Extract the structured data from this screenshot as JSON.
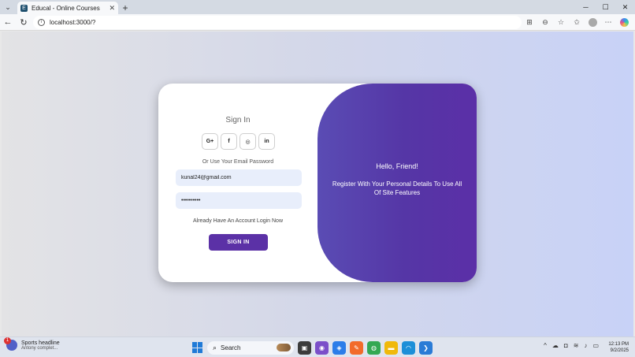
{
  "browser": {
    "tab_title": "Educal - Online Courses",
    "tab_favicon": "E",
    "tab_close": "✕",
    "new_tab": "+",
    "address": "localhost:3000/?",
    "controls": {
      "minimize": "─",
      "maximize": "☐",
      "close": "✕"
    },
    "nav": {
      "back": "←",
      "refresh": "↻"
    }
  },
  "signin": {
    "title": "Sign In",
    "social": [
      {
        "label": "G+",
        "icon": "google-plus-icon"
      },
      {
        "label": "f",
        "icon": "facebook-icon"
      },
      {
        "label": "◎",
        "icon": "github-icon"
      },
      {
        "label": "in",
        "icon": "linkedin-icon"
      }
    ],
    "alt_text": "Or Use Your Email Password",
    "email_value": "kunal24@gmail.com",
    "password_value": "••••••••••",
    "account_text": "Already Have An Account Login Now",
    "button_label": "SIGN IN"
  },
  "panel": {
    "title": "Hello, Friend!",
    "text": "Register With Your Personal Details To Use All Of Site Features"
  },
  "taskbar": {
    "widget_title": "Sports headline",
    "widget_sub": "Antony complet...",
    "widget_badge": "1",
    "search_label": "Search",
    "time": "12:13 PM",
    "date": "9/2/2025"
  },
  "colors": {
    "accent": "#5b31a6",
    "panel_start": "#5a4cb4",
    "panel_end": "#5b2fa7",
    "input_bg": "#e8eefb"
  }
}
